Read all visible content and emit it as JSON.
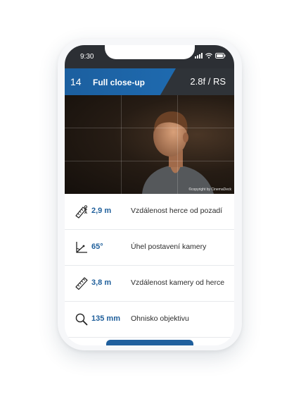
{
  "status_bar": {
    "time": "9:30"
  },
  "header": {
    "shot_number": "14",
    "shot_name": "Full close-up",
    "lens_spec": "2.8f / RS"
  },
  "photo": {
    "copyright": "©copyright by CinemaDeck"
  },
  "specs": [
    {
      "icon": "ruler-person-icon",
      "value": "2,9 m",
      "label": "Vzdálenost herce od pozadí"
    },
    {
      "icon": "angle-icon",
      "value": "65°",
      "label": "Úhel postavení kamery"
    },
    {
      "icon": "ruler-icon",
      "value": "3,8 m",
      "label": "Vzdálenost kamery od herce"
    },
    {
      "icon": "magnifier-icon",
      "value": "135 mm",
      "label": "Ohnisko objektivu"
    }
  ],
  "colors": {
    "accent": "#1e6aaf",
    "header_dark": "#2f3338",
    "value_text": "#1f5f9b"
  }
}
